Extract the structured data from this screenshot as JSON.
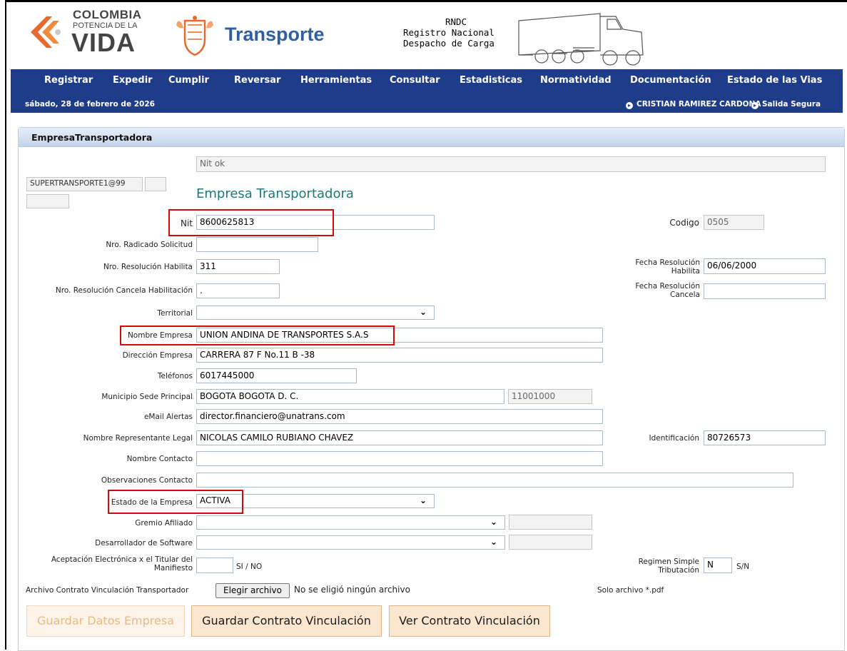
{
  "header": {
    "logo_line1": "COLOMBIA",
    "logo_line2": "POTENCIA DE LA",
    "logo_line3": "VIDA",
    "brand": "Transporte",
    "rndc_line1": "RNDC",
    "rndc_line2": "Registro   Nacional",
    "rndc_line3": "Despacho de Carga"
  },
  "nav": {
    "items": [
      "Registrar",
      "Expedir",
      "Cumplir",
      "Reversar",
      "Herramientas",
      "Consultar",
      "Estadisticas",
      "Normatividad",
      "Documentación",
      "Estado de las Vias"
    ],
    "date": "sábado, 28 de febrero de 2026",
    "user": "CRISTIAN RAMIREZ CARDONA",
    "logout": "Salida Segura"
  },
  "panel": {
    "title": "EmpresaTransportadora",
    "status_message": "Nit ok",
    "user_field": "SUPERTRANSPORTE1@99",
    "form_title": "Empresa Transportadora"
  },
  "form": {
    "nit_label": "Nit",
    "nit": "8600625813",
    "codigo_label": "Codigo",
    "codigo": "0505",
    "radicado_label": "Nro. Radicado Solicitud",
    "radicado": "",
    "res_habilita_label": "Nro. Resolución Habilita",
    "res_habilita": "311",
    "fecha_habilita_label": "Fecha Resolución Habilita",
    "fecha_habilita": "06/06/2000",
    "res_cancela_label": "Nro. Resolución Cancela Habilitación",
    "res_cancela": ".",
    "fecha_cancela_label": "Fecha Resolución Cancela",
    "fecha_cancela": "",
    "territorial_label": "Territorial",
    "territorial": "",
    "nombre_label": "Nombre Empresa",
    "nombre": "UNION ANDINA DE TRANSPORTES S.A.S",
    "direccion_label": "Dirección Empresa",
    "direccion": "CARRERA 87 F No.11 B -38",
    "telefonos_label": "Teléfonos",
    "telefonos": "6017445000",
    "municipio_label": "Municipio Sede Principal",
    "municipio": "BOGOTA BOGOTA D. C.",
    "municipio_code": "11001000",
    "email_label": "eMail Alertas",
    "email": "director.financiero@unatrans.com",
    "representante_label": "Nombre Representante Legal",
    "representante": "NICOLAS CAMILO RUBIANO CHAVEZ",
    "identificacion_label": "Identificación",
    "identificacion": "80726573",
    "contacto_label": "Nombre Contacto",
    "contacto": "",
    "observaciones_label": "Observaciones Contacto",
    "observaciones": "",
    "estado_label": "Estado de la Empresa",
    "estado": "ACTIVA",
    "gremio_label": "Gremio Afiliado",
    "gremio": "",
    "desarrollador_label": "Desarrollador de Software",
    "desarrollador": "",
    "aceptacion_label": "Aceptación Electrónica x el Titular del Manifiesto",
    "aceptacion": "",
    "aceptacion_hint": "SI / NO",
    "regimen_label": "Regimen Simple Tributación",
    "regimen": "N",
    "regimen_hint": "S/N",
    "archivo_label": "Archivo Contrato Vinculación Transportador",
    "archivo_button": "Elegir archivo",
    "archivo_status": "No se eligió ningún archivo",
    "archivo_hint": "Solo archivo *.pdf"
  },
  "buttons": {
    "guardar_empresa": "Guardar Datos Empresa",
    "guardar_contrato": "Guardar Contrato Vinculación",
    "ver_contrato": "Ver Contrato Vinculación"
  },
  "colors": {
    "nav": "#1f3c88",
    "brand": "#2f5f9e",
    "highlight": "#d10b0b",
    "button": "#fbe6cf"
  }
}
